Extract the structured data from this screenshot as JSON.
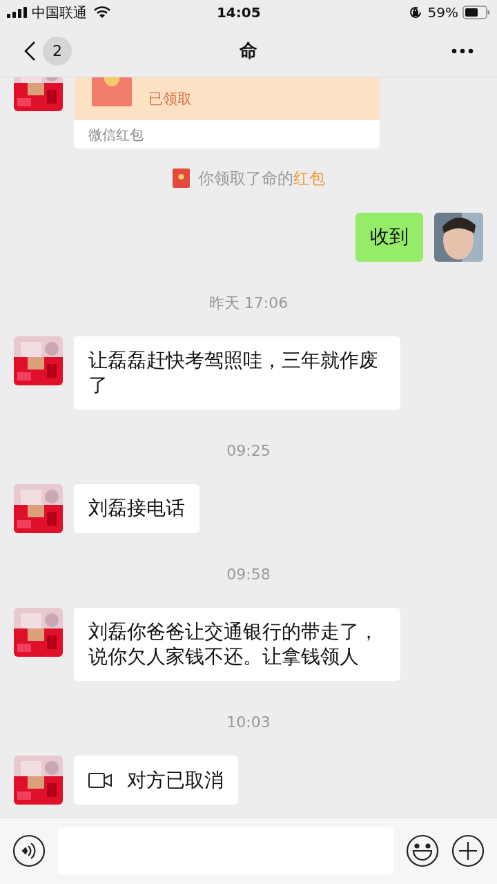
{
  "status_bar": {
    "carrier": "中国联通",
    "time": "14:05",
    "battery": "59%"
  },
  "nav": {
    "badge": "2",
    "title": "命"
  },
  "messages": [
    {
      "kind": "redpacket",
      "status": "已领取",
      "footer": "微信红包"
    },
    {
      "kind": "system",
      "text": "你领取了命的",
      "link": "红包"
    },
    {
      "kind": "text",
      "sent": true,
      "text": "收到"
    },
    {
      "kind": "time",
      "text": "昨天 17:06"
    },
    {
      "kind": "text",
      "sent": false,
      "text": "让磊磊赶快考驾照哇，三年就作废了"
    },
    {
      "kind": "time",
      "text": "09:25"
    },
    {
      "kind": "text",
      "sent": false,
      "text": "刘磊接电话"
    },
    {
      "kind": "time",
      "text": "09:58"
    },
    {
      "kind": "text",
      "sent": false,
      "text": "刘磊你爸爸让交通银行的带走了，说你欠人家钱不还。让拿钱领人"
    },
    {
      "kind": "time",
      "text": "10:03"
    },
    {
      "kind": "video",
      "sent": false,
      "text": "对方已取消"
    }
  ]
}
